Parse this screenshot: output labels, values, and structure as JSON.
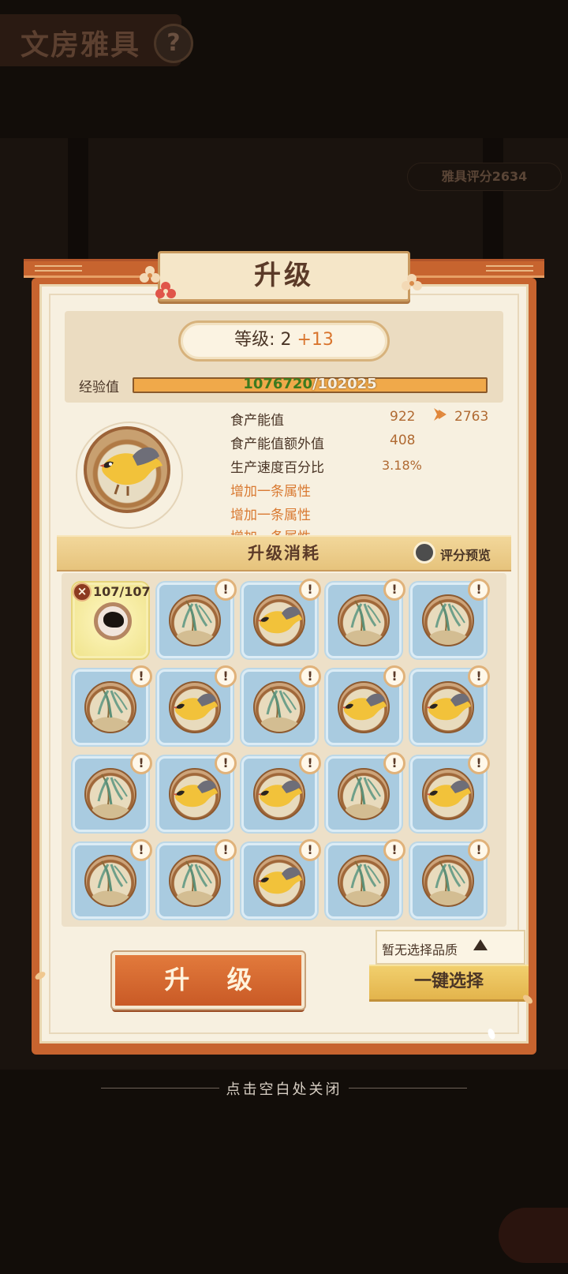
{
  "background": {
    "title": "文房雅具",
    "help_symbol": "?",
    "score_label": "雅具评分",
    "score_value": "2634"
  },
  "dialog": {
    "title": "升级",
    "level_label": "等级:",
    "level_value": "2",
    "level_gain": "+13",
    "exp_label": "经验值",
    "exp_current": "1076720",
    "exp_separator": "/",
    "exp_max": "102025",
    "stats": [
      {
        "label": "食产能值",
        "value": "922",
        "next": "2763"
      },
      {
        "label": "食产能值额外值",
        "value": "408"
      },
      {
        "label": "生产速度百分比",
        "value": "3.18%"
      }
    ],
    "bonus_rows": [
      "增加一条属性",
      "增加一条属性",
      "增加一条属性"
    ],
    "cost_title": "升级消耗",
    "preview_label": "评分预览",
    "selected_item": {
      "count": "107/107",
      "remove_symbol": "×"
    },
    "slot_badge": "!",
    "slot_types": [
      "willow",
      "oriole",
      "willow",
      "willow",
      "willow",
      "oriole",
      "willow",
      "oriole",
      "oriole",
      "willow",
      "oriole",
      "oriole",
      "willow",
      "oriole",
      "willow",
      "willow",
      "oriole",
      "willow",
      "willow"
    ],
    "upgrade_button": "升 级",
    "quality_label": "暂无选择品质",
    "one_click_button": "一键选择",
    "close_hint": "点击空白处关闭"
  },
  "colors": {
    "accent_orange": "#c7642f",
    "slot_blue": "#a9cbe0",
    "exp_bar": "#f0a94a",
    "exp_current": "#3d7a1e"
  }
}
